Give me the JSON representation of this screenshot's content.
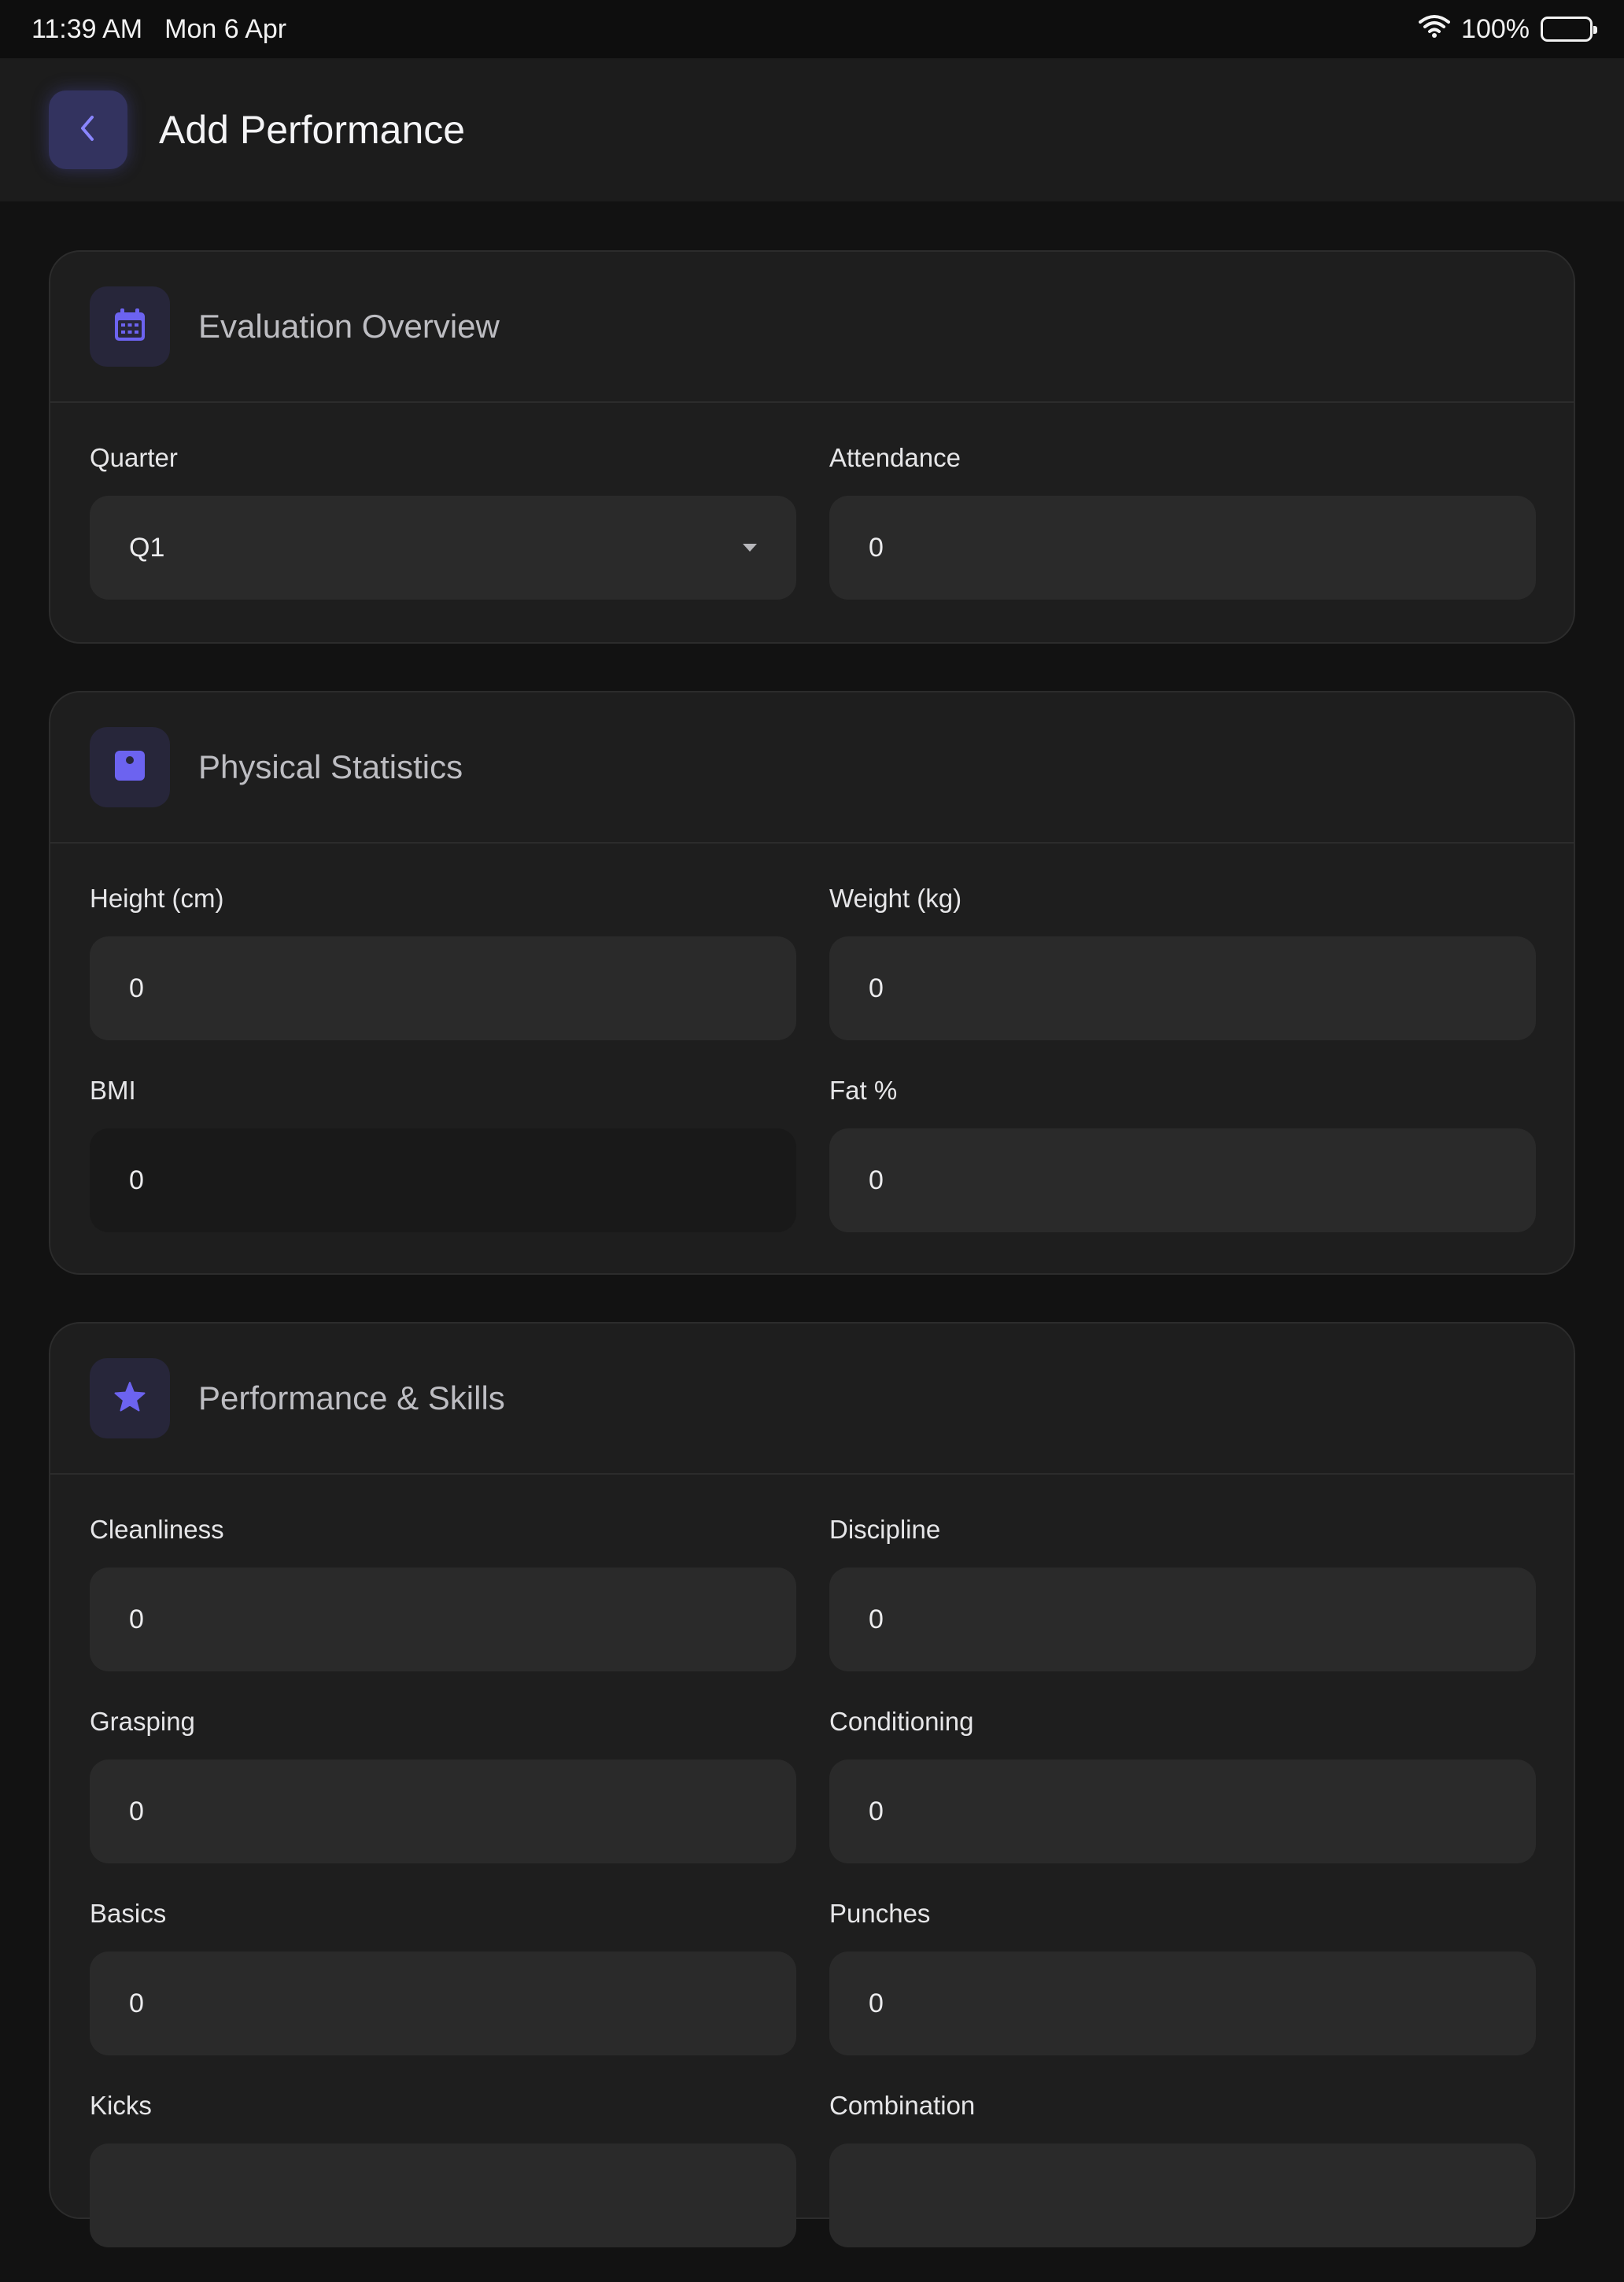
{
  "status_bar": {
    "time": "11:39 AM",
    "date": "Mon 6 Apr",
    "battery": "100%"
  },
  "header": {
    "title": "Add Performance",
    "back_icon": "chevron-left-icon"
  },
  "colors": {
    "background": "#121212",
    "card": "#1e1e1e",
    "accent": "#6c63f0",
    "input": "#2a2a2a"
  },
  "evaluation": {
    "title": "Evaluation Overview",
    "icon": "calendar-icon",
    "quarter_label": "Quarter",
    "quarter_value": "Q1",
    "attendance_label": "Attendance",
    "attendance_value": "0"
  },
  "physical": {
    "title": "Physical Statistics",
    "icon": "scale-icon",
    "height_label": "Height (cm)",
    "height_value": "0",
    "weight_label": "Weight (kg)",
    "weight_value": "0",
    "bmi_label": "BMI",
    "bmi_value": "0",
    "fat_label": "Fat %",
    "fat_value": "0"
  },
  "skills": {
    "title": "Performance & Skills",
    "icon": "star-icon",
    "cleanliness_label": "Cleanliness",
    "cleanliness_value": "0",
    "discipline_label": "Discipline",
    "discipline_value": "0",
    "grasping_label": "Grasping",
    "grasping_value": "0",
    "conditioning_label": "Conditioning",
    "conditioning_value": "0",
    "basics_label": "Basics",
    "basics_value": "0",
    "punches_label": "Punches",
    "punches_value": "0",
    "kicks_label": "Kicks",
    "kicks_value": "",
    "combination_label": "Combination",
    "combination_value": ""
  }
}
